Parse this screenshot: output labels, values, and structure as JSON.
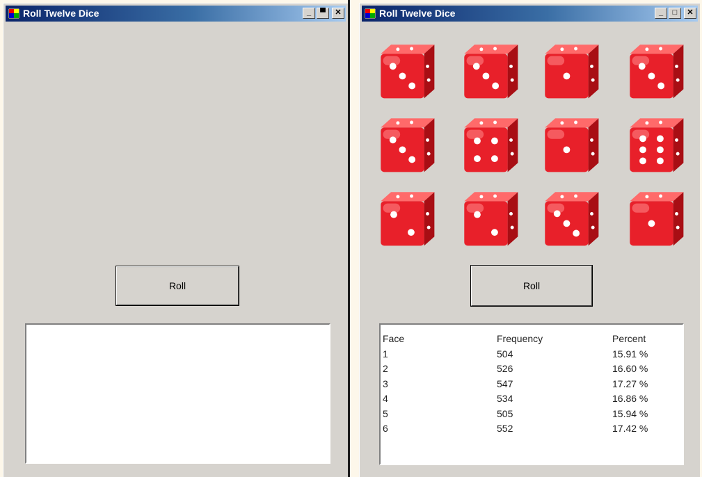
{
  "left_window": {
    "title": "Roll Twelve Dice",
    "roll_button": "Roll",
    "output_text": ""
  },
  "right_window": {
    "title": "Roll Twelve Dice",
    "dice_faces": [
      3,
      3,
      1,
      3,
      3,
      4,
      1,
      6,
      2,
      2,
      3,
      1
    ],
    "roll_button": "Roll",
    "stats": {
      "headers": [
        "Face",
        "Frequency",
        "Percent"
      ],
      "rows": [
        [
          "1",
          "504",
          "15.91 %"
        ],
        [
          "2",
          "526",
          "16.60 %"
        ],
        [
          "3",
          "547",
          "17.27 %"
        ],
        [
          "4",
          "534",
          "16.86 %"
        ],
        [
          "5",
          "505",
          "15.94 %"
        ],
        [
          "6",
          "552",
          "17.42 %"
        ]
      ]
    }
  },
  "colors": {
    "window_bg": "#d6d3ce",
    "title_gradient_start": "#0a246a",
    "title_gradient_end": "#a6caf0",
    "die_red": "#e8202a",
    "page_bg": "#fdf7ea"
  },
  "icons": {
    "app": "app-window-icon",
    "minimize": "minimize-icon",
    "maximize": "maximize-icon",
    "close": "close-icon"
  }
}
